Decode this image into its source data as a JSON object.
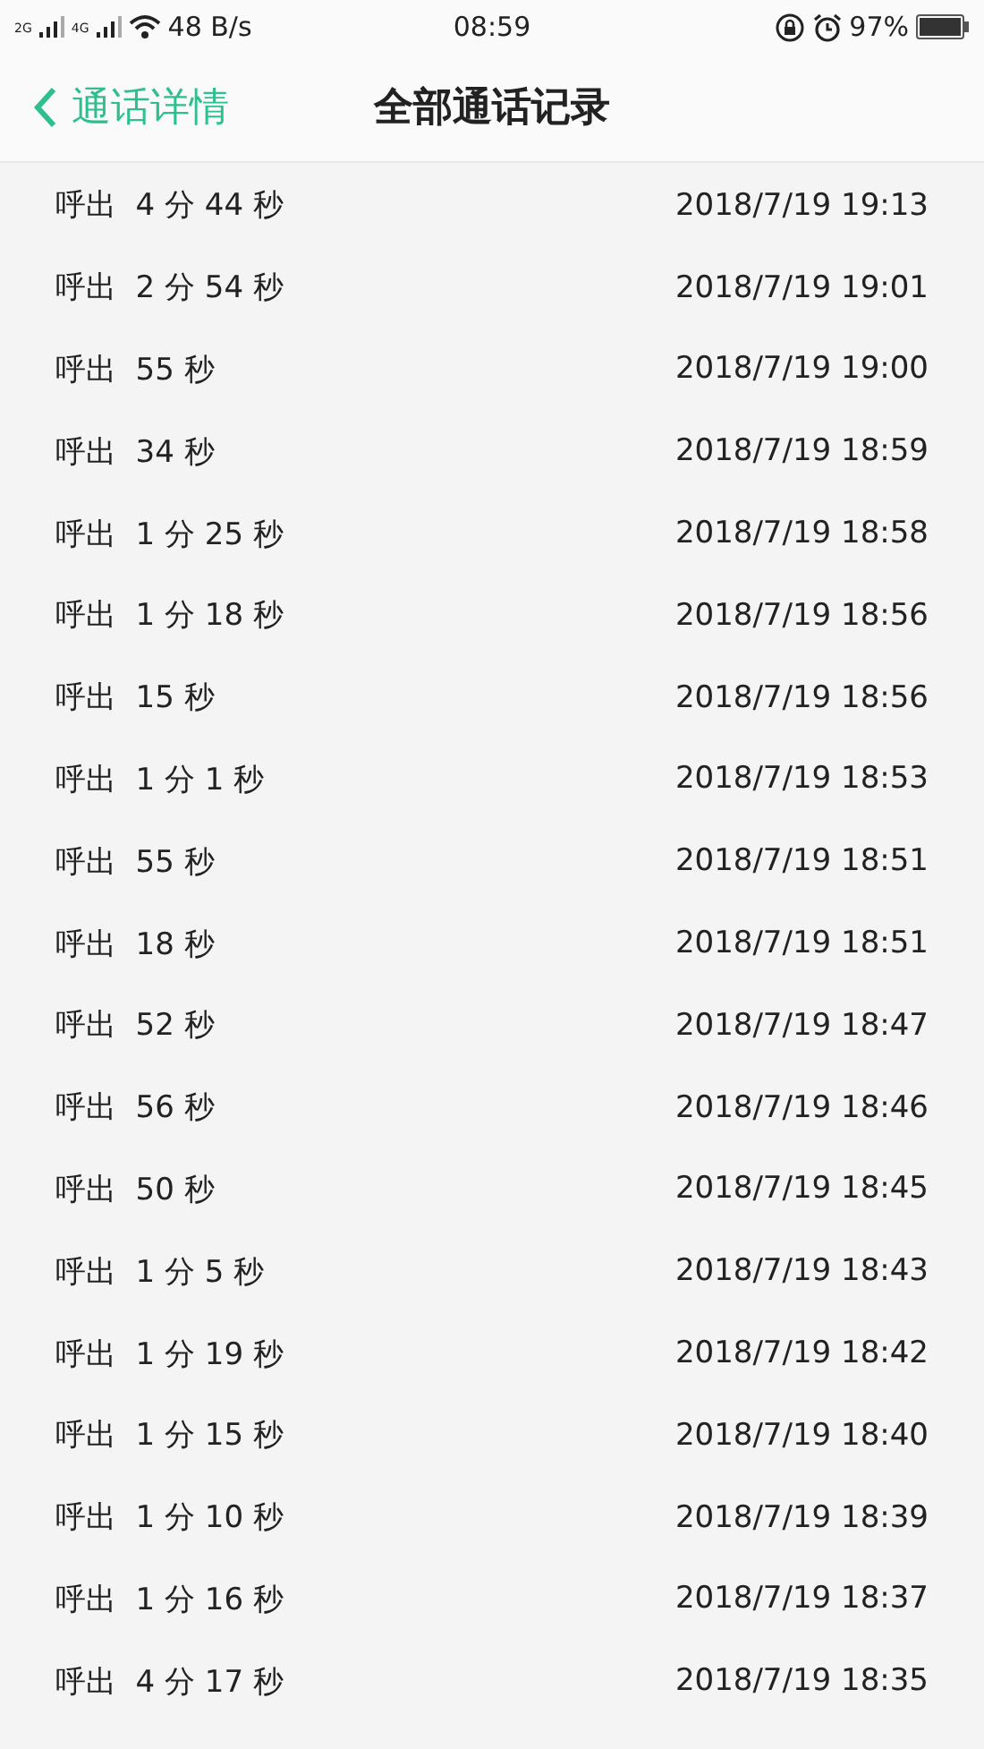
{
  "status_bar": {
    "network_left": "2G",
    "network_right": "4G",
    "speed": "48 B/s",
    "time": "08:59",
    "battery": "97%"
  },
  "header": {
    "back_label": "通话详情",
    "title": "全部通话记录"
  },
  "calls": [
    {
      "type": "呼出",
      "duration": "4 分 44 秒",
      "time": "2018/7/19 19:13"
    },
    {
      "type": "呼出",
      "duration": "2 分 54 秒",
      "time": "2018/7/19 19:01"
    },
    {
      "type": "呼出",
      "duration": "55 秒",
      "time": "2018/7/19 19:00"
    },
    {
      "type": "呼出",
      "duration": "34 秒",
      "time": "2018/7/19 18:59"
    },
    {
      "type": "呼出",
      "duration": "1 分 25 秒",
      "time": "2018/7/19 18:58"
    },
    {
      "type": "呼出",
      "duration": "1 分 18 秒",
      "time": "2018/7/19 18:56"
    },
    {
      "type": "呼出",
      "duration": "15 秒",
      "time": "2018/7/19 18:56"
    },
    {
      "type": "呼出",
      "duration": "1 分 1 秒",
      "time": "2018/7/19 18:53"
    },
    {
      "type": "呼出",
      "duration": "55 秒",
      "time": "2018/7/19 18:51"
    },
    {
      "type": "呼出",
      "duration": "18 秒",
      "time": "2018/7/19 18:51"
    },
    {
      "type": "呼出",
      "duration": "52 秒",
      "time": "2018/7/19 18:47"
    },
    {
      "type": "呼出",
      "duration": "56 秒",
      "time": "2018/7/19 18:46"
    },
    {
      "type": "呼出",
      "duration": "50 秒",
      "time": "2018/7/19 18:45"
    },
    {
      "type": "呼出",
      "duration": "1 分 5 秒",
      "time": "2018/7/19 18:43"
    },
    {
      "type": "呼出",
      "duration": "1 分 19 秒",
      "time": "2018/7/19 18:42"
    },
    {
      "type": "呼出",
      "duration": "1 分 15 秒",
      "time": "2018/7/19 18:40"
    },
    {
      "type": "呼出",
      "duration": "1 分 10 秒",
      "time": "2018/7/19 18:39"
    },
    {
      "type": "呼出",
      "duration": "1 分 16 秒",
      "time": "2018/7/19 18:37"
    },
    {
      "type": "呼出",
      "duration": "4 分 17 秒",
      "time": "2018/7/19 18:35"
    }
  ]
}
